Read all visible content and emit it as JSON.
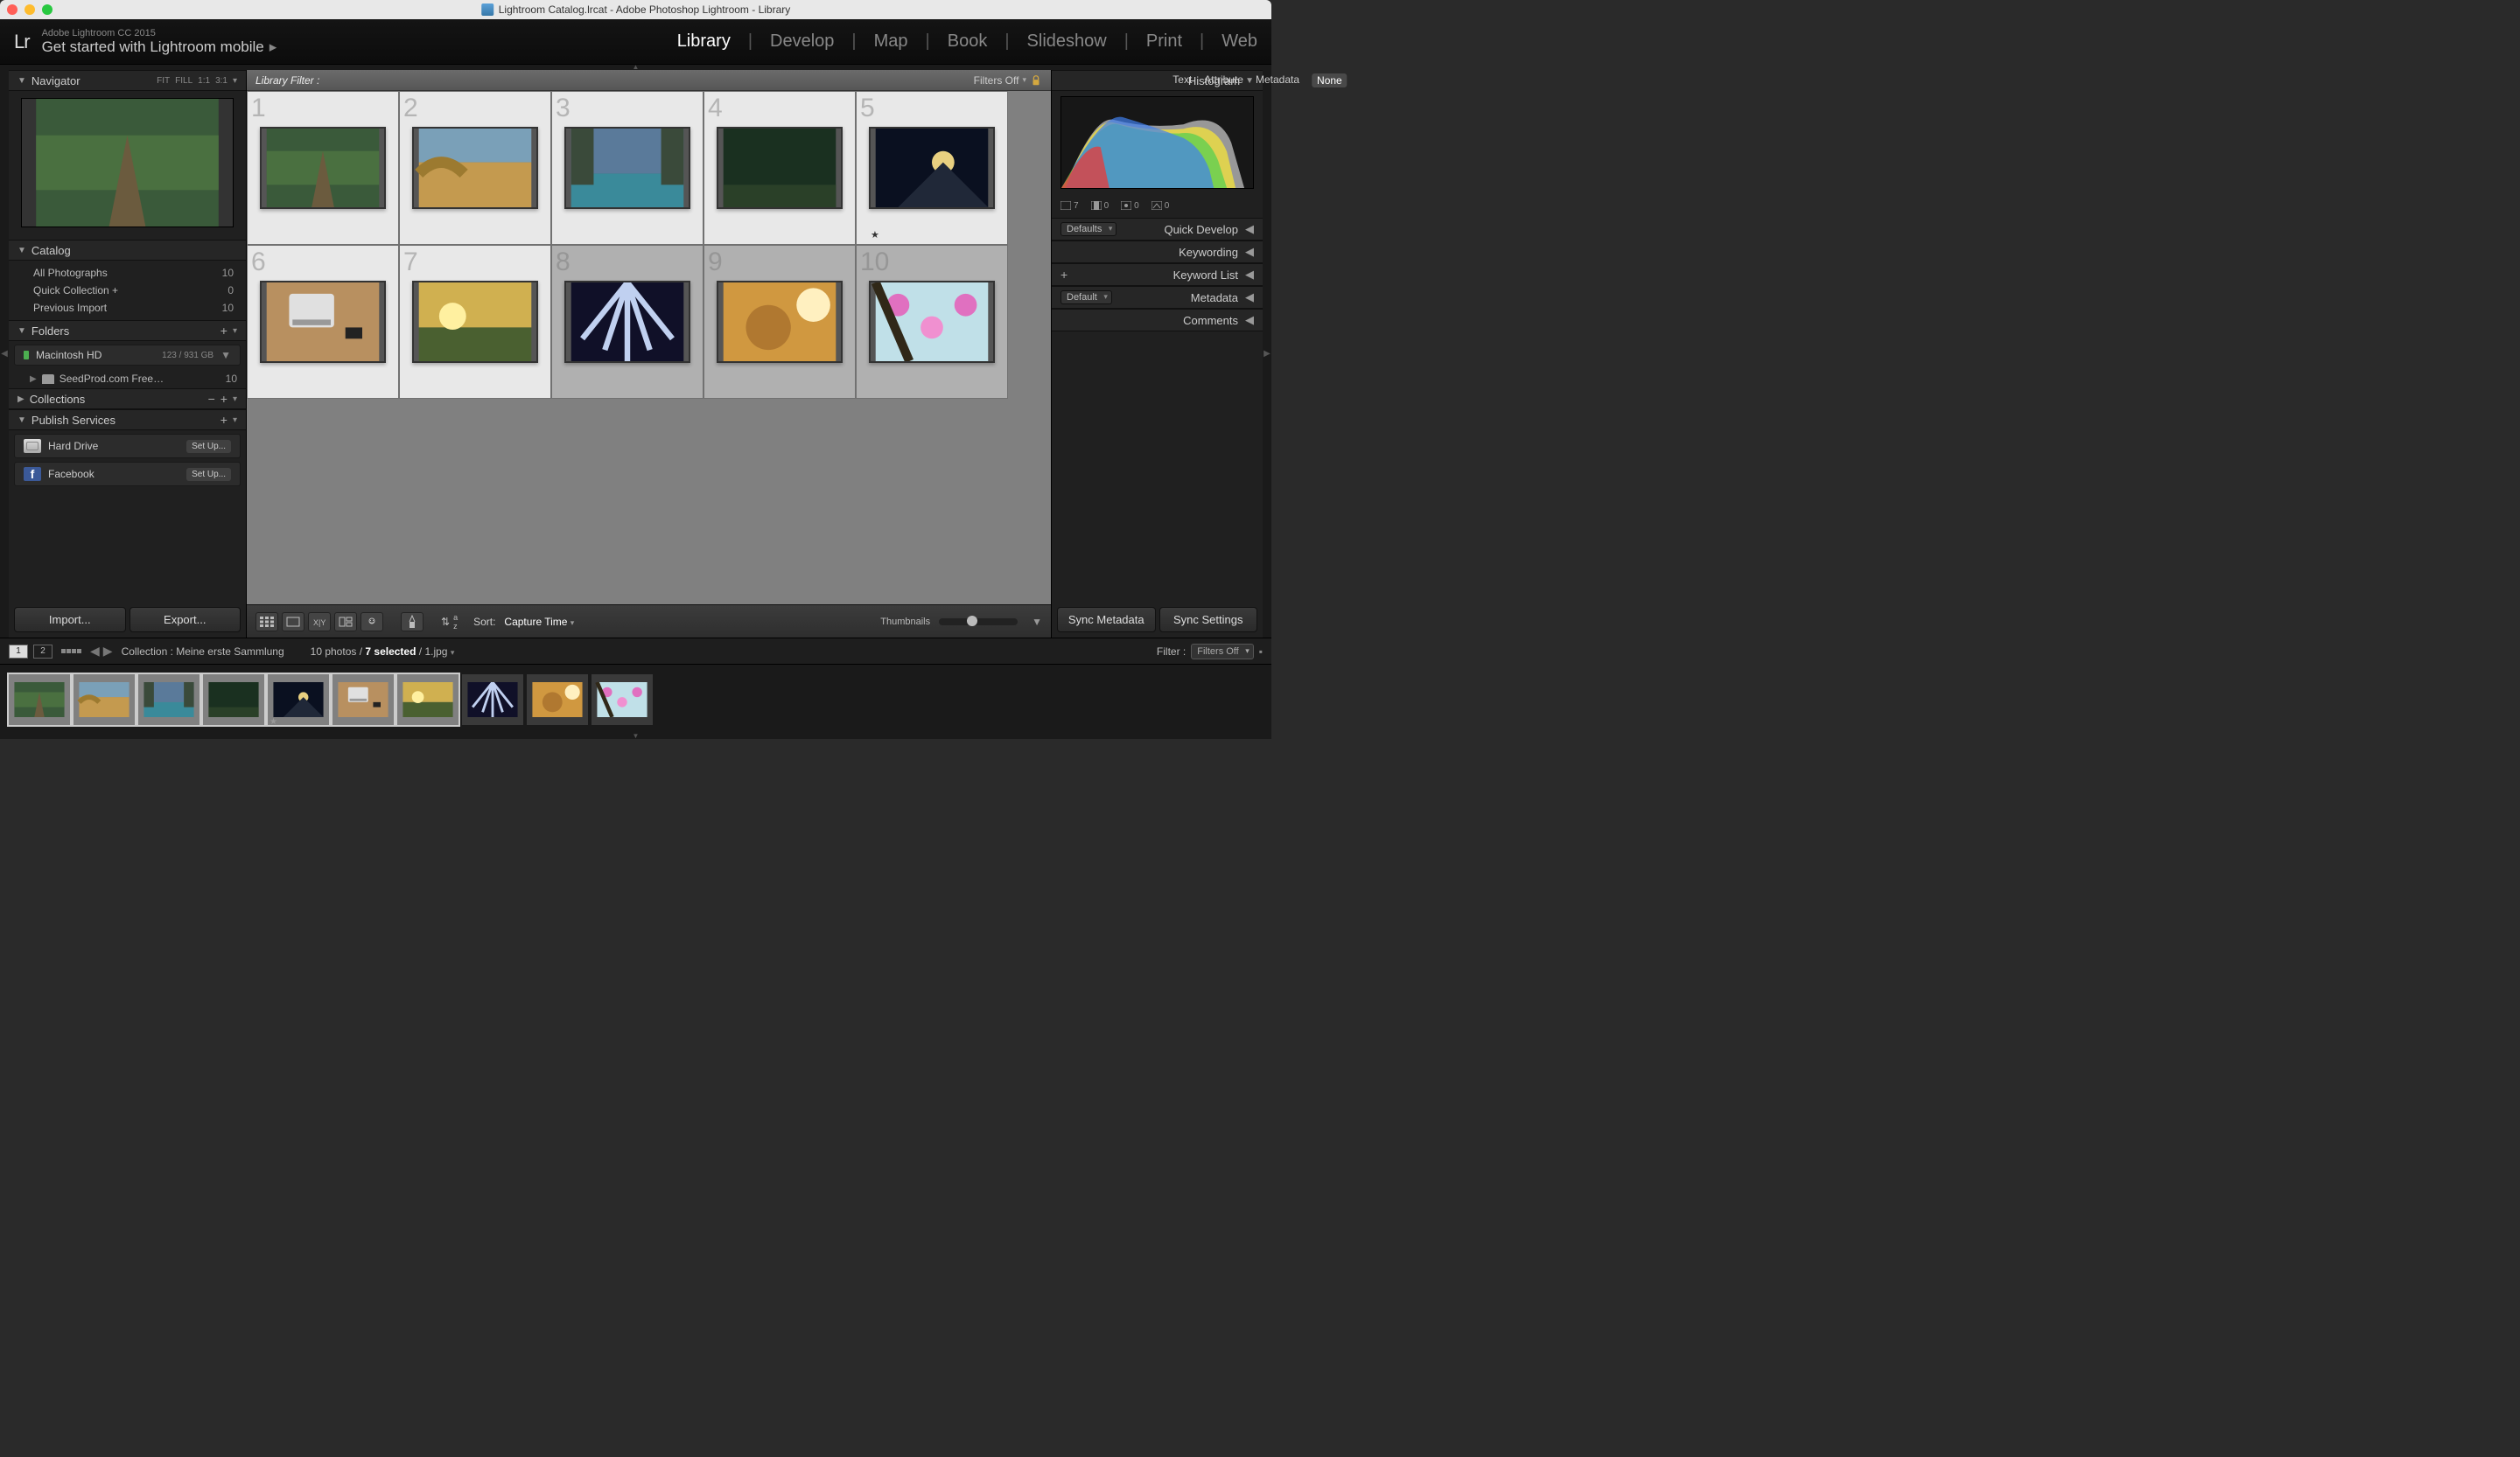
{
  "titlebar": "Lightroom Catalog.lrcat - Adobe Photoshop Lightroom - Library",
  "header": {
    "version": "Adobe Lightroom CC 2015",
    "tagline": "Get started with Lightroom mobile",
    "modules": [
      "Library",
      "Develop",
      "Map",
      "Book",
      "Slideshow",
      "Print",
      "Web"
    ],
    "active_module": "Library"
  },
  "navigator": {
    "title": "Navigator",
    "zoom_modes": [
      "FIT",
      "FILL",
      "1:1",
      "3:1"
    ]
  },
  "catalog": {
    "title": "Catalog",
    "items": [
      {
        "label": "All Photographs",
        "count": "10"
      },
      {
        "label": "Quick Collection  +",
        "count": "0"
      },
      {
        "label": "Previous Import",
        "count": "10"
      }
    ]
  },
  "folders": {
    "title": "Folders",
    "volume": "Macintosh HD",
    "usage": "123 / 931 GB",
    "subfolder_label": "SeedProd.com Free…",
    "subfolder_count": "10"
  },
  "collections": {
    "title": "Collections"
  },
  "publish": {
    "title": "Publish Services",
    "items": [
      {
        "label": "Hard Drive",
        "button": "Set Up..."
      },
      {
        "label": "Facebook",
        "button": "Set Up..."
      }
    ]
  },
  "actions": {
    "import": "Import...",
    "export": "Export..."
  },
  "filter_bar": {
    "label": "Library Filter :",
    "tabs": [
      "Text",
      "Attribute",
      "Metadata",
      "None"
    ],
    "active": "None",
    "filters_off": "Filters Off"
  },
  "grid": {
    "cells": [
      {
        "n": "1",
        "selected": true,
        "starred": false
      },
      {
        "n": "2",
        "selected": true,
        "starred": false
      },
      {
        "n": "3",
        "selected": true,
        "starred": false
      },
      {
        "n": "4",
        "selected": true,
        "starred": false
      },
      {
        "n": "5",
        "selected": true,
        "starred": true
      },
      {
        "n": "6",
        "selected": true,
        "starred": false
      },
      {
        "n": "7",
        "selected": true,
        "starred": false
      },
      {
        "n": "8",
        "selected": false,
        "starred": false
      },
      {
        "n": "9",
        "selected": false,
        "starred": false
      },
      {
        "n": "10",
        "selected": false,
        "starred": false
      }
    ]
  },
  "toolbar": {
    "sort_label": "Sort:",
    "sort_value": "Capture Time",
    "slider_label": "Thumbnails"
  },
  "status": {
    "path_label": "Collection : Meine erste Sammlung",
    "count_text_before": "10 photos /",
    "count_text_selected": "7 selected",
    "count_text_after": "/ 1.jpg",
    "filter_label": "Filter :",
    "filter_value": "Filters Off"
  },
  "right": {
    "histogram_title": "Histogram",
    "hist_stats": {
      "photos": "7",
      "a": "0",
      "b": "0",
      "c": "0"
    },
    "defaults_label": "Defaults",
    "default_label": "Default",
    "rows": [
      "Quick Develop",
      "Keywording",
      "Keyword List",
      "Metadata",
      "Comments"
    ]
  },
  "sync": {
    "meta": "Sync Metadata",
    "settings": "Sync Settings"
  },
  "thumb_svgs": [
    "<svg viewBox='0 0 10 7'><rect width='10' height='7' fill='#3a5a3a'/><rect y='2' width='10' height='3' fill='#4a7040'/><path d='M4 7 L5 2 L6 7' fill='#6b5b3e'/></svg>",
    "<svg viewBox='0 0 10 7'><rect width='10' height='3' fill='#7aa0b8'/><rect y='3' width='10' height='4' fill='#c49a4f'/><path d='M0 4 Q2 2 4 4' stroke='#9c7a30' fill='none'/></svg>",
    "<svg viewBox='0 0 10 7'><rect width='10' height='4' fill='#5a7a9a'/><rect y='4' width='10' height='3' fill='#3a8a9a'/><rect x='0' y='0' width='2' height='5' fill='#3a4a3a'/><rect x='8' y='0' width='2' height='5' fill='#3a4a3a'/></svg>",
    "<svg viewBox='0 0 10 7'><rect width='10' height='7' fill='#1a3020'/><rect y='5' width='10' height='2' fill='#2a4028'/></svg>",
    "<svg viewBox='0 0 10 7'><rect width='10' height='7' fill='#0a1020'/><circle cx='6' cy='3' r='1' fill='#e8d080'/><path d='M2 7 L6 3 L10 7' fill='#202838'/></svg>",
    "<svg viewBox='0 0 10 7'><rect width='10' height='7' fill='#b89060'/><rect x='2' y='1' width='4' height='3' rx='0.3' fill='#e0e0e0'/><rect x='2.3' y='3.3' width='3.4' height='0.5' fill='#999'/><rect x='7' y='4' width='1.5' height='1' fill='#222'/></svg>",
    "<svg viewBox='0 0 10 7'><rect width='10' height='4' fill='#d0b050'/><rect y='4' width='10' height='3' fill='#4a6030'/><circle cx='3' cy='3' r='1.2' fill='#fff0a0'/></svg>",
    "<svg viewBox='0 0 10 7'><rect width='10' height='7' fill='#101028'/><path d='M5 0 L1 5 M5 0 L3 6 M5 0 L5 7 M5 0 L7 6 M5 0 L9 5' stroke='#c0d0f0' stroke-width='0.5'/></svg>",
    "<svg viewBox='0 0 10 7'><rect width='10' height='7' fill='#d09840'/><circle cx='4' cy='4' r='2' fill='#b07830'/><circle cx='8' cy='2' r='1.5' fill='#fff0c0'/></svg>",
    "<svg viewBox='0 0 10 7'><rect width='10' height='7' fill='#c0e0e8'/><circle cx='2' cy='2' r='1' fill='#e070c0'/><circle cx='5' cy='4' r='1' fill='#f090d0'/><circle cx='8' cy='2' r='1' fill='#e070c0'/><path d='M0 0 L3 7' stroke='#302818' stroke-width='0.8'/></svg>"
  ]
}
